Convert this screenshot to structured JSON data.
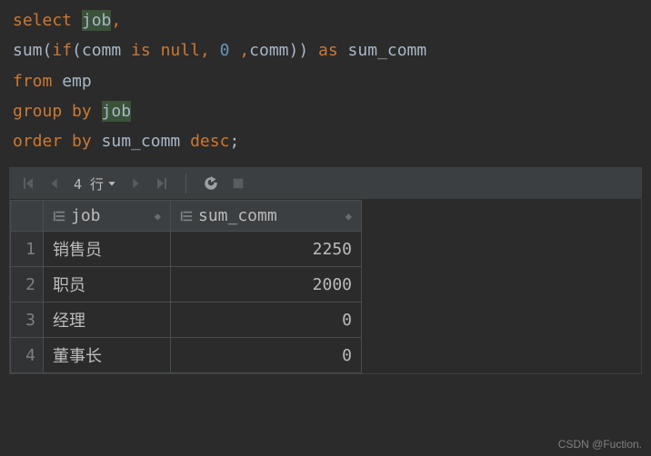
{
  "sql": {
    "tokens": [
      [
        {
          "t": "select ",
          "c": "kw"
        },
        {
          "t": "job",
          "c": "hl"
        },
        {
          "t": ",",
          "c": "comma"
        }
      ],
      [
        {
          "t": "       ",
          "c": ""
        },
        {
          "t": "sum",
          "c": "func"
        },
        {
          "t": "(",
          "c": ""
        },
        {
          "t": "if",
          "c": "kw"
        },
        {
          "t": "(comm ",
          "c": ""
        },
        {
          "t": "is null",
          "c": "kw"
        },
        {
          "t": ", ",
          "c": "comma"
        },
        {
          "t": "0",
          "c": "num"
        },
        {
          "t": " ",
          "c": ""
        },
        {
          "t": ",",
          "c": "comma"
        },
        {
          "t": "comm)) ",
          "c": ""
        },
        {
          "t": "as ",
          "c": "kw"
        },
        {
          "t": "sum_comm",
          "c": "ident"
        }
      ],
      [
        {
          "t": "from ",
          "c": "kw"
        },
        {
          "t": "emp",
          "c": "ident"
        }
      ],
      [
        {
          "t": "group by ",
          "c": "kw"
        },
        {
          "t": "job",
          "c": "hl"
        }
      ],
      [
        {
          "t": "order by ",
          "c": "kw"
        },
        {
          "t": "sum_comm ",
          "c": "ident"
        },
        {
          "t": "desc",
          "c": "kw"
        },
        {
          "t": ";",
          "c": ""
        }
      ]
    ]
  },
  "toolbar": {
    "row_count_label": "4 行"
  },
  "table": {
    "columns": [
      {
        "name": "job",
        "align": "left"
      },
      {
        "name": "sum_comm",
        "align": "right"
      }
    ],
    "rows": [
      {
        "n": "1",
        "job": "销售员",
        "sum_comm": "2250"
      },
      {
        "n": "2",
        "job": "职员",
        "sum_comm": "2000"
      },
      {
        "n": "3",
        "job": "经理",
        "sum_comm": "0"
      },
      {
        "n": "4",
        "job": "董事长",
        "sum_comm": "0"
      }
    ]
  },
  "watermark": "CSDN @Fuction."
}
